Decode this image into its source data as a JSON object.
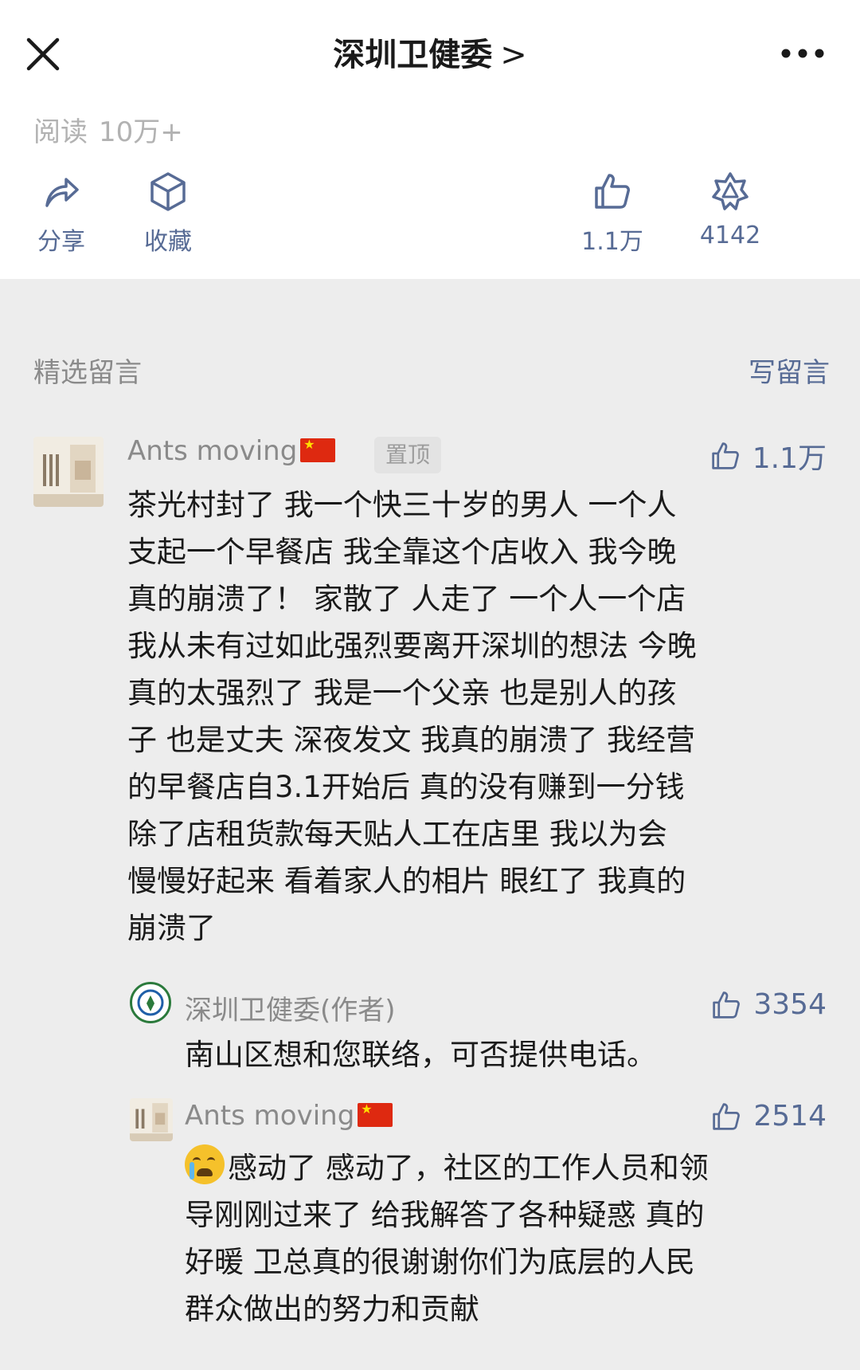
{
  "header": {
    "title": "深圳卫健委",
    "title_chevron": ">",
    "reads_label": "阅读",
    "reads_value": "10万+"
  },
  "actions": {
    "share_label": "分享",
    "collect_label": "收藏",
    "like_count": "1.1万",
    "wow_count": "4142"
  },
  "comments_section": {
    "title": "精选留言",
    "write_label": "写留言"
  },
  "comments": [
    {
      "author": "Ants moving",
      "pinned_label": "置顶",
      "likes": "1.1万",
      "lines": [
        "茶光村封了 我一个快三十岁的男人 一个人",
        "支起一个早餐店 我全靠这个店收入 我今晚",
        "真的崩溃了！ 家散了 人走了 一个人一个店",
        "我从未有过如此强烈要离开深圳的想法 今晚",
        "真的太强烈了 我是一个父亲  也是别人的孩",
        "子 也是丈夫  深夜发文 我真的崩溃了 我经营",
        "的早餐店自3.1开始后 真的没有赚到一分钱",
        "除了店租货款每天贴人工在店里  我以为会",
        "慢慢好起来 看着家人的相片 眼红了 我真的",
        "崩溃了"
      ]
    },
    {
      "author": "深圳卫健委(作者)",
      "likes": "3354",
      "lines": [
        "南山区想和您联络，可否提供电话。"
      ]
    },
    {
      "author": "Ants moving",
      "likes": "2514",
      "lines": [
        "感动了 感动了，社区的工作人员和领",
        "导刚刚过来了 给我解答了各种疑惑 真的",
        "好暖 卫总真的很谢谢你们为底层的人民",
        "群众做出的努力和贡献"
      ]
    }
  ],
  "colors": {
    "link": "#576b95",
    "muted": "#8a8a8a",
    "background": "#ededed"
  }
}
